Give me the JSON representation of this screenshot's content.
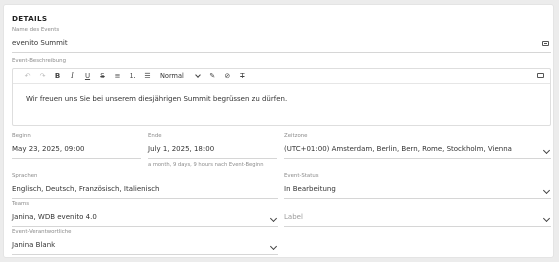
{
  "section": {
    "title": "DETAILS"
  },
  "event_name": {
    "label": "Name des Events",
    "value": "evenito Summit",
    "translate_icon": "translate-icon"
  },
  "description": {
    "label": "Event-Beschreibung",
    "toolbar": {
      "undo": "↶",
      "redo": "↷",
      "bold": "B",
      "italic": "I",
      "underline": "U",
      "strike": "S",
      "align": "≡",
      "ordered_list": "⒈",
      "bullet_list": "☰",
      "style_select": "Normal",
      "pen": "✎",
      "link": "🔗",
      "clear": "T̸"
    },
    "body": "Wir freuen uns Sie bei unserem diesjährigen Summit begrüssen zu dürfen."
  },
  "start": {
    "label": "Beginn",
    "value": "May 23, 2025, 09:00"
  },
  "end": {
    "label": "Ende",
    "value": "July 1, 2025, 18:00",
    "hint": "a month, 9 days, 9 hours nach Event-Beginn"
  },
  "timezone": {
    "label": "Zeitzone",
    "value": "(UTC+01:00) Amsterdam, Berlin, Bern, Rome, Stockholm, Vienna"
  },
  "languages": {
    "label": "Sprachen",
    "value": "Englisch, Deutsch, Französisch, Italienisch"
  },
  "status": {
    "label": "Event-Status",
    "value": "In Bearbeitung"
  },
  "teams": {
    "label": "Teams",
    "value": "Janina, WDB evenito 4.0"
  },
  "label_field": {
    "placeholder": "Label"
  },
  "responsible": {
    "label": "Event-Verantwortliche",
    "value": "Janina Blank"
  }
}
